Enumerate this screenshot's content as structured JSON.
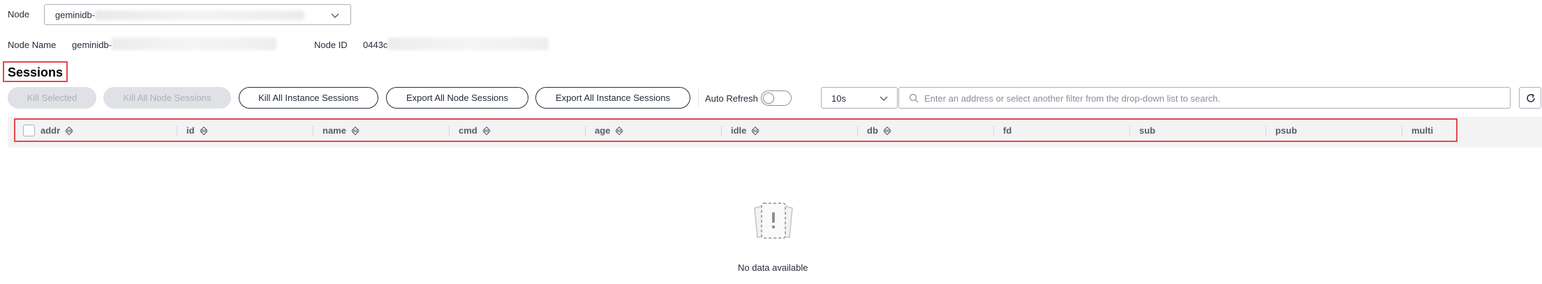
{
  "node": {
    "label": "Node",
    "selected_value": "geminidb-"
  },
  "info": {
    "node_name_label": "Node Name",
    "node_name_value": "geminidb-",
    "node_id_label": "Node ID",
    "node_id_value": "0443c"
  },
  "sessions": {
    "title": "Sessions"
  },
  "toolbar": {
    "kill_selected": "Kill Selected",
    "kill_all_node": "Kill All Node Sessions",
    "kill_all_instance": "Kill All Instance Sessions",
    "export_all_node": "Export All Node Sessions",
    "export_all_instance": "Export All Instance Sessions",
    "auto_refresh_label": "Auto Refresh",
    "auto_refresh_on": false,
    "interval_value": "10s",
    "search_placeholder": "Enter an address or select another filter from the drop-down list to search."
  },
  "table": {
    "columns": [
      {
        "label": "addr",
        "sortable": true
      },
      {
        "label": "id",
        "sortable": true
      },
      {
        "label": "name",
        "sortable": true
      },
      {
        "label": "cmd",
        "sortable": true
      },
      {
        "label": "age",
        "sortable": true
      },
      {
        "label": "idle",
        "sortable": true
      },
      {
        "label": "db",
        "sortable": true
      },
      {
        "label": "fd",
        "sortable": false
      },
      {
        "label": "sub",
        "sortable": false
      },
      {
        "label": "psub",
        "sortable": false
      },
      {
        "label": "multi",
        "sortable": false
      }
    ],
    "rows": [],
    "empty_text": "No data available"
  },
  "icons": {
    "select_chevron": "chevron-down-icon",
    "search": "search-icon",
    "refresh": "refresh-icon",
    "sort": "sort-icon",
    "empty": "empty-state-icon"
  },
  "colors": {
    "highlight_border": "#e5484d",
    "text_primary": "#252b3a",
    "text_secondary": "#8a8e99",
    "disabled_bg": "#dfe1e6"
  }
}
